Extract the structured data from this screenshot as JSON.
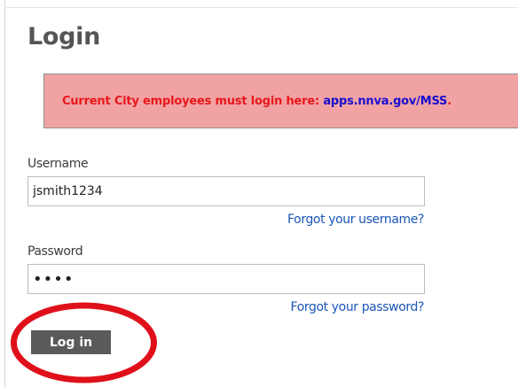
{
  "page": {
    "title": "Login"
  },
  "notice": {
    "prefix": "Current City employees must login here:",
    "link_text": "apps.nnva.gov/MSS",
    "suffix": "."
  },
  "username": {
    "label": "Username",
    "value": "jsmith1234",
    "forgot_link": "Forgot your username?"
  },
  "password": {
    "label": "Password",
    "value": "abcd",
    "forgot_link": "Forgot your password?"
  },
  "login_button": {
    "label": "Log in"
  },
  "colors": {
    "notice_bg": "#f1a3a3",
    "notice_text": "#e8161c",
    "notice_link": "#1a0ecf",
    "link": "#1a56b8",
    "button_bg": "#5a5a5a",
    "highlight": "#e0101a"
  }
}
